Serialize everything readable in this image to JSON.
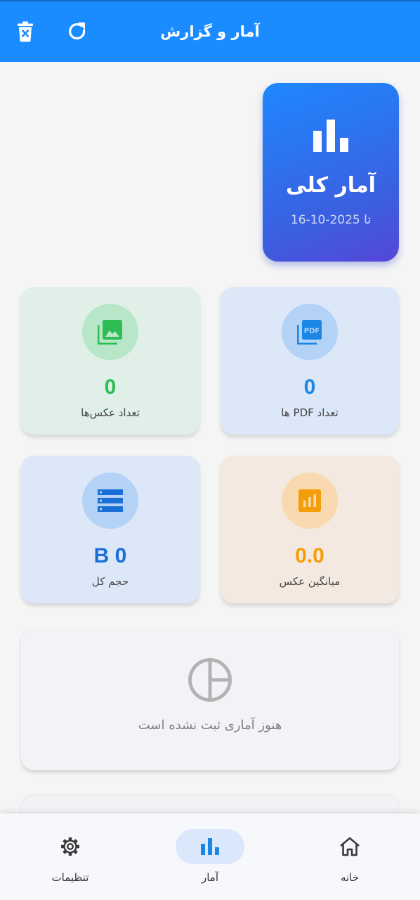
{
  "app_bar": {
    "title": "آمار و گزارش",
    "delete_icon": "delete-forever-icon",
    "refresh_icon": "refresh-icon"
  },
  "overview_card": {
    "icon": "bar-chart-icon",
    "title": "آمار کلی",
    "subtitle": "تا 2025-10-16"
  },
  "stat_cards": {
    "pdf": {
      "icon": "pdf-file-icon",
      "value": "0",
      "label": "تعداد PDF ها",
      "color": "#1a87e6"
    },
    "images": {
      "icon": "photo-library-icon",
      "value": "0",
      "label": "تعداد عکس‌ها",
      "color": "#2ebd55"
    },
    "avg": {
      "icon": "analytics-icon",
      "value": "0.0",
      "label": "میانگین عکس",
      "color": "#f59e0b"
    },
    "size": {
      "icon": "storage-icon",
      "value": "B 0",
      "label": "حجم کل",
      "color": "#1a6fd6"
    }
  },
  "empty_state": {
    "icon": "pie-chart-outline-icon",
    "text": "هنوز آماری ثبت نشده است"
  },
  "bottom_nav": {
    "items": [
      {
        "label": "تنظیمات",
        "icon": "gear-icon",
        "active": false
      },
      {
        "label": "آمار",
        "icon": "bar-chart-icon",
        "active": true
      },
      {
        "label": "خانه",
        "icon": "home-icon",
        "active": false
      }
    ],
    "active_color": "#1a87e6"
  },
  "colors": {
    "primary": "#1a8cff",
    "background": "#f5f5f5"
  }
}
